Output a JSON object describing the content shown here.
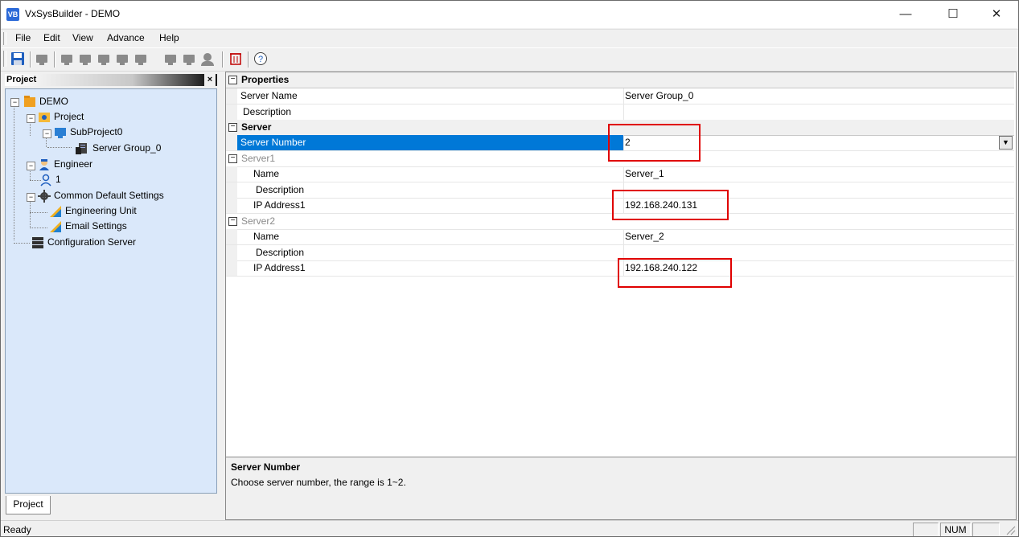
{
  "window": {
    "title": "VxSysBuilder - DEMO",
    "app_icon_text": "VB",
    "minimize": "—",
    "maximize": "☐",
    "close": "✕"
  },
  "menu": [
    "File",
    "Edit",
    "View",
    "Advance",
    "Help"
  ],
  "left_panel": {
    "title": "Project",
    "close": "×",
    "tab": "Project",
    "tree": {
      "root": "DEMO",
      "project": "Project",
      "subproject": "SubProject0",
      "server_group": "Server Group_0",
      "engineer": "Engineer",
      "engineer_child": "1",
      "common": "Common Default Settings",
      "eng_unit": "Engineering Unit",
      "email": "Email Settings",
      "config_server": "Configuration Server"
    }
  },
  "grid": {
    "properties_cat": "Properties",
    "server_name_label": "Server Name",
    "server_name_value": "Server Group_0",
    "description_label": "Description",
    "server_cat": "Server",
    "server_number_label": "Server Number",
    "server_number_value": "2",
    "server1": {
      "label": "Server1",
      "name_label": "Name",
      "name_value": "Server_1",
      "desc_label": "Description",
      "ip_label": "IP Address1",
      "ip_value": "192.168.240.131"
    },
    "server2": {
      "label": "Server2",
      "name_label": "Name",
      "name_value": "Server_2",
      "desc_label": "Description",
      "ip_label": "IP Address1",
      "ip_value": "192.168.240.122"
    },
    "expand_symbol": "⊟"
  },
  "description": {
    "title": "Server Number",
    "text": "Choose server number, the range is 1~2."
  },
  "status": {
    "text": "Ready",
    "num": "NUM"
  },
  "colors": {
    "selection": "#0078d7",
    "highlight": "#e00000",
    "tree_bg": "#dae8fa"
  }
}
